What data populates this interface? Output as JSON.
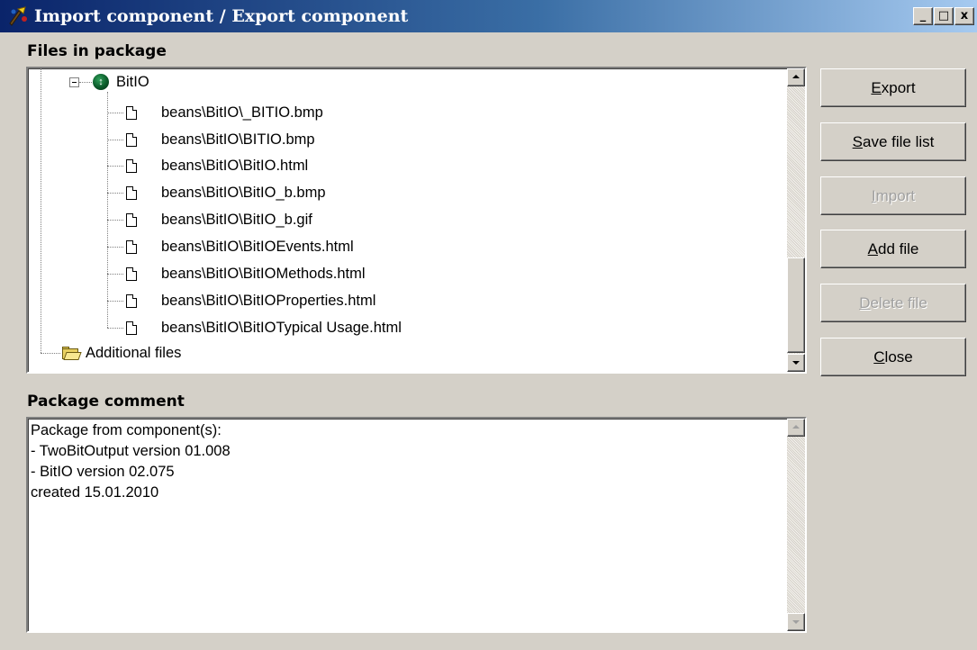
{
  "window": {
    "title": "Import component / Export component",
    "controls": {
      "minimize": "_",
      "maximize": "□",
      "close": "x"
    }
  },
  "files_section": {
    "label": "Files in package",
    "root": {
      "label": "BitIO",
      "icon": "bean-icon",
      "expanded": true,
      "children": [
        "beans\\BitIO\\_BITIO.bmp",
        "beans\\BitIO\\BITIO.bmp",
        "beans\\BitIO\\BitIO.html",
        "beans\\BitIO\\BitIO_b.bmp",
        "beans\\BitIO\\BitIO_b.gif",
        "beans\\BitIO\\BitIOEvents.html",
        "beans\\BitIO\\BitIOMethods.html",
        "beans\\BitIO\\BitIOProperties.html",
        "beans\\BitIO\\BitIOTypical Usage.html"
      ]
    },
    "additional": {
      "label": "Additional files",
      "icon": "open-folder-icon"
    }
  },
  "comment_section": {
    "label": "Package comment",
    "text": "Package from component(s):\n- TwoBitOutput version 01.008\n- BitIO version 02.075\ncreated 15.01.2010"
  },
  "buttons": {
    "export": {
      "pre": "",
      "key": "E",
      "post": "xport",
      "enabled": true
    },
    "save_list": {
      "pre": "",
      "key": "S",
      "post": "ave file list",
      "enabled": true
    },
    "import": {
      "pre": "",
      "key": "I",
      "post": "mport",
      "enabled": false
    },
    "add_file": {
      "pre": "",
      "key": "A",
      "post": "dd file",
      "enabled": true
    },
    "delete_file": {
      "pre": "",
      "key": "D",
      "post": "elete file",
      "enabled": false
    },
    "close": {
      "pre": "",
      "key": "C",
      "post": "lose",
      "enabled": true
    }
  },
  "colors": {
    "titlebar_start": "#0a246a",
    "titlebar_end": "#a6caf0",
    "face": "#d4d0c8",
    "disabled_text": "#a0a0a0"
  }
}
